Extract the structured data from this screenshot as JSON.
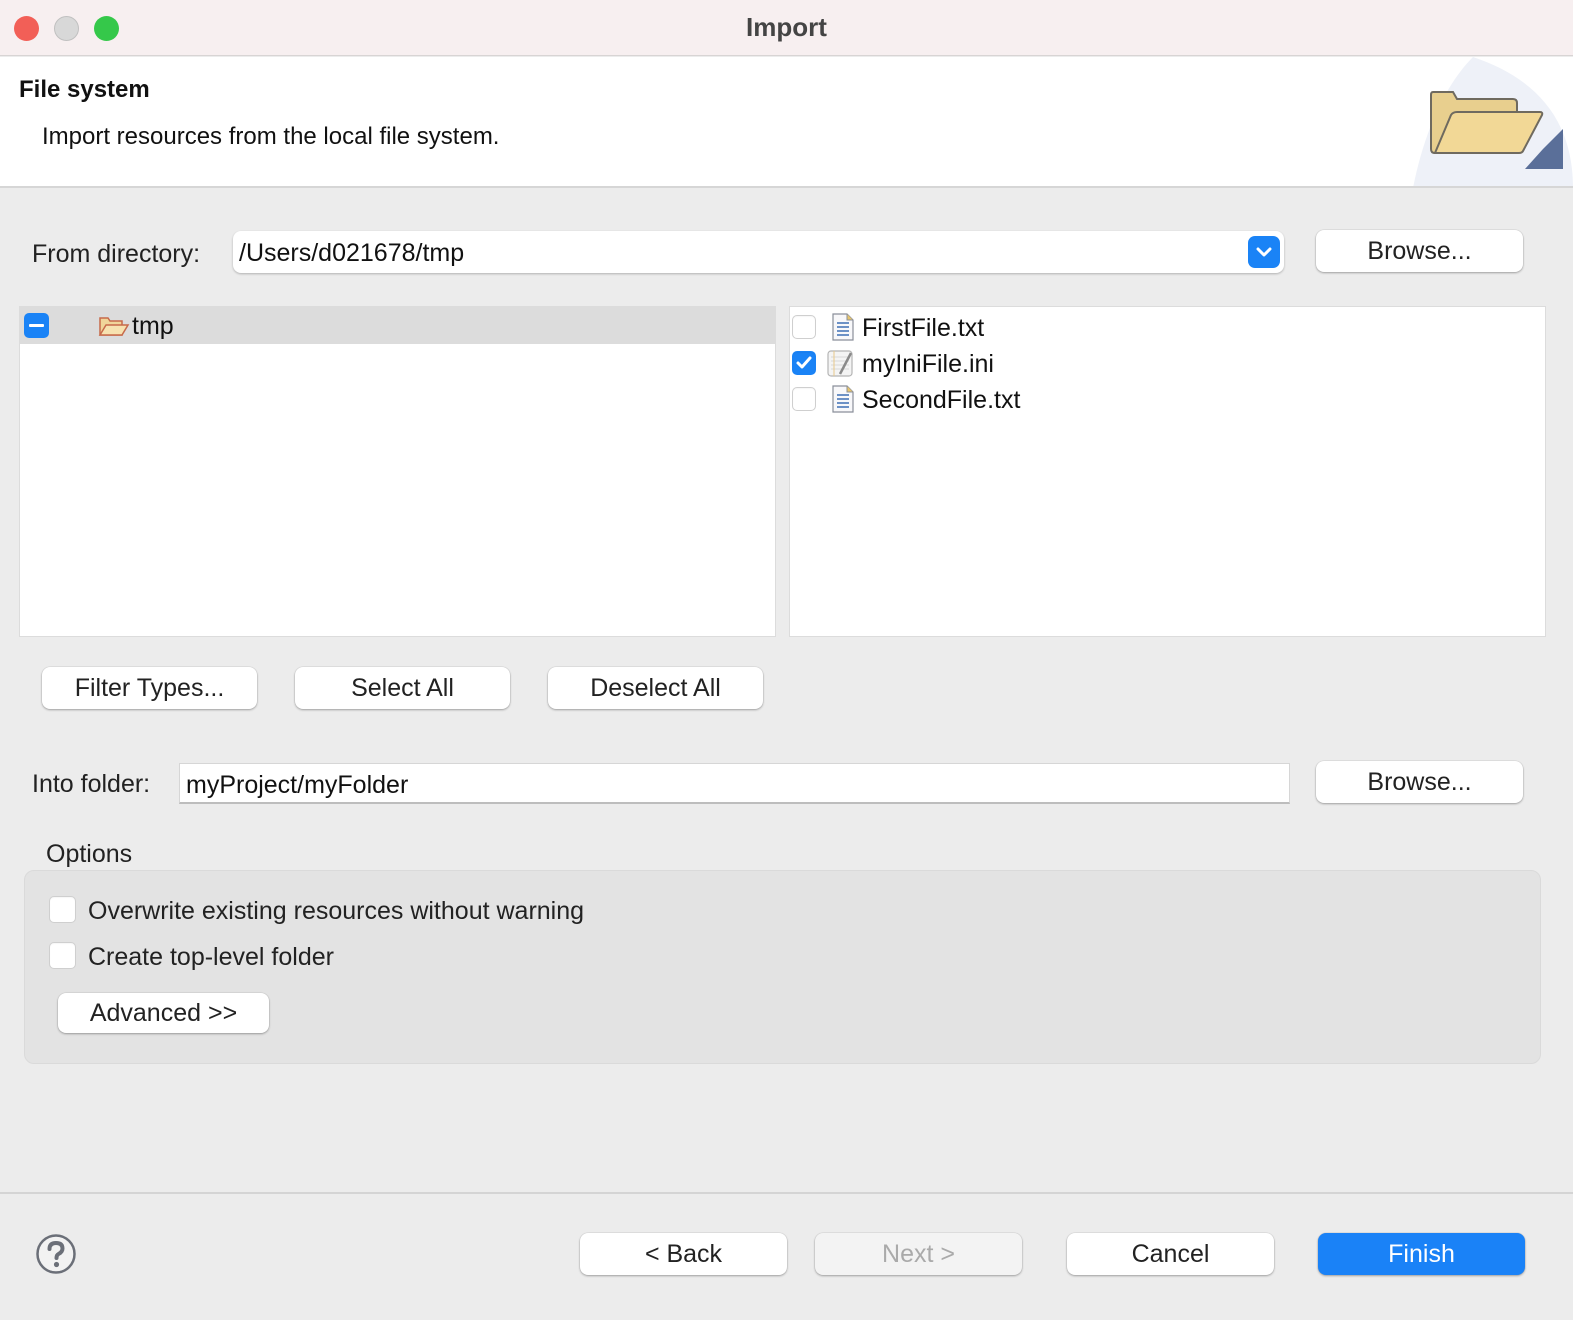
{
  "window": {
    "title": "Import",
    "controls": [
      "close",
      "minimize",
      "maximize"
    ]
  },
  "header": {
    "title": "File system",
    "description": "Import resources from the local file system.",
    "icon": "folder-open-icon"
  },
  "from_directory": {
    "label": "From directory:",
    "value": "/Users/d021678/tmp",
    "browse_label": "Browse..."
  },
  "folder_tree": {
    "items": [
      {
        "label": "tmp",
        "state": "partially-selected",
        "icon": "folder-open-icon"
      }
    ]
  },
  "file_list": {
    "items": [
      {
        "label": "FirstFile.txt",
        "checked": false,
        "icon": "text-file-icon"
      },
      {
        "label": "myIniFile.ini",
        "checked": true,
        "icon": "ini-file-icon"
      },
      {
        "label": "SecondFile.txt",
        "checked": false,
        "icon": "text-file-icon"
      }
    ]
  },
  "selection_buttons": {
    "filter_types": "Filter Types...",
    "select_all": "Select All",
    "deselect_all": "Deselect All"
  },
  "into_folder": {
    "label": "Into folder:",
    "value": "myProject/myFolder",
    "browse_label": "Browse..."
  },
  "options": {
    "title": "Options",
    "checkboxes": [
      {
        "label": "Overwrite existing resources without warning",
        "checked": false
      },
      {
        "label": "Create top-level folder",
        "checked": false
      }
    ],
    "advanced_label": "Advanced >>"
  },
  "footer": {
    "back": "< Back",
    "next": "Next >",
    "cancel": "Cancel",
    "finish": "Finish",
    "next_enabled": false
  },
  "colors": {
    "accent": "#1a83f6",
    "titlebar_bg": "#f7eff0",
    "dialog_bg": "#ececec",
    "close": "#f25f57",
    "maximize": "#35c84a"
  }
}
